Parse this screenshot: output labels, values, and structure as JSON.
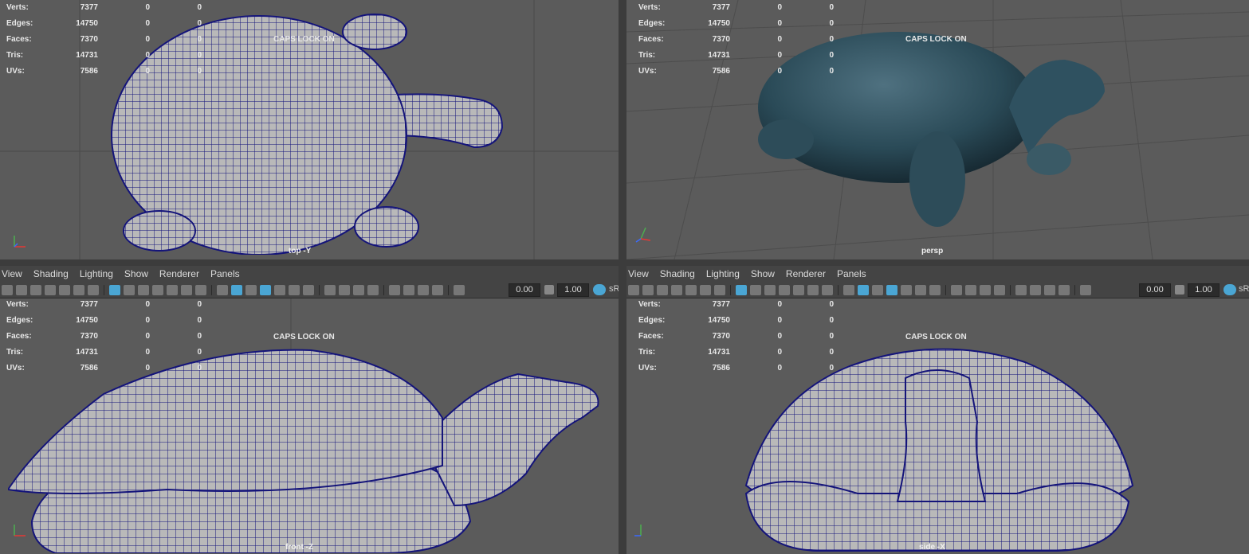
{
  "menu": [
    "View",
    "Shading",
    "Lighting",
    "Show",
    "Renderer",
    "Panels"
  ],
  "toolbar": {
    "value1": "0.00",
    "value2": "1.00",
    "color_label": "sR"
  },
  "hud": [
    {
      "label": "Verts:",
      "v1": "7377",
      "v2": "0",
      "v3": "0"
    },
    {
      "label": "Edges:",
      "v1": "14750",
      "v2": "0",
      "v3": "0"
    },
    {
      "label": "Faces:",
      "v1": "7370",
      "v2": "0",
      "v3": "0"
    },
    {
      "label": "Tris:",
      "v1": "14731",
      "v2": "0",
      "v3": "0"
    },
    {
      "label": "UVs:",
      "v1": "7586",
      "v2": "0",
      "v3": "0"
    }
  ],
  "caps_lock": "CAPS LOCK ON",
  "viewports": {
    "top": "top -Y",
    "persp": "persp",
    "front": "front -Z",
    "side": "side -X"
  },
  "axis": {
    "x": "x",
    "y": "y",
    "z": "z"
  },
  "colors": {
    "viewport_bg": "#5b5b5b",
    "wire": "#14147a",
    "mesh": "#b9b9b9",
    "accent": "#4aa6d4"
  }
}
